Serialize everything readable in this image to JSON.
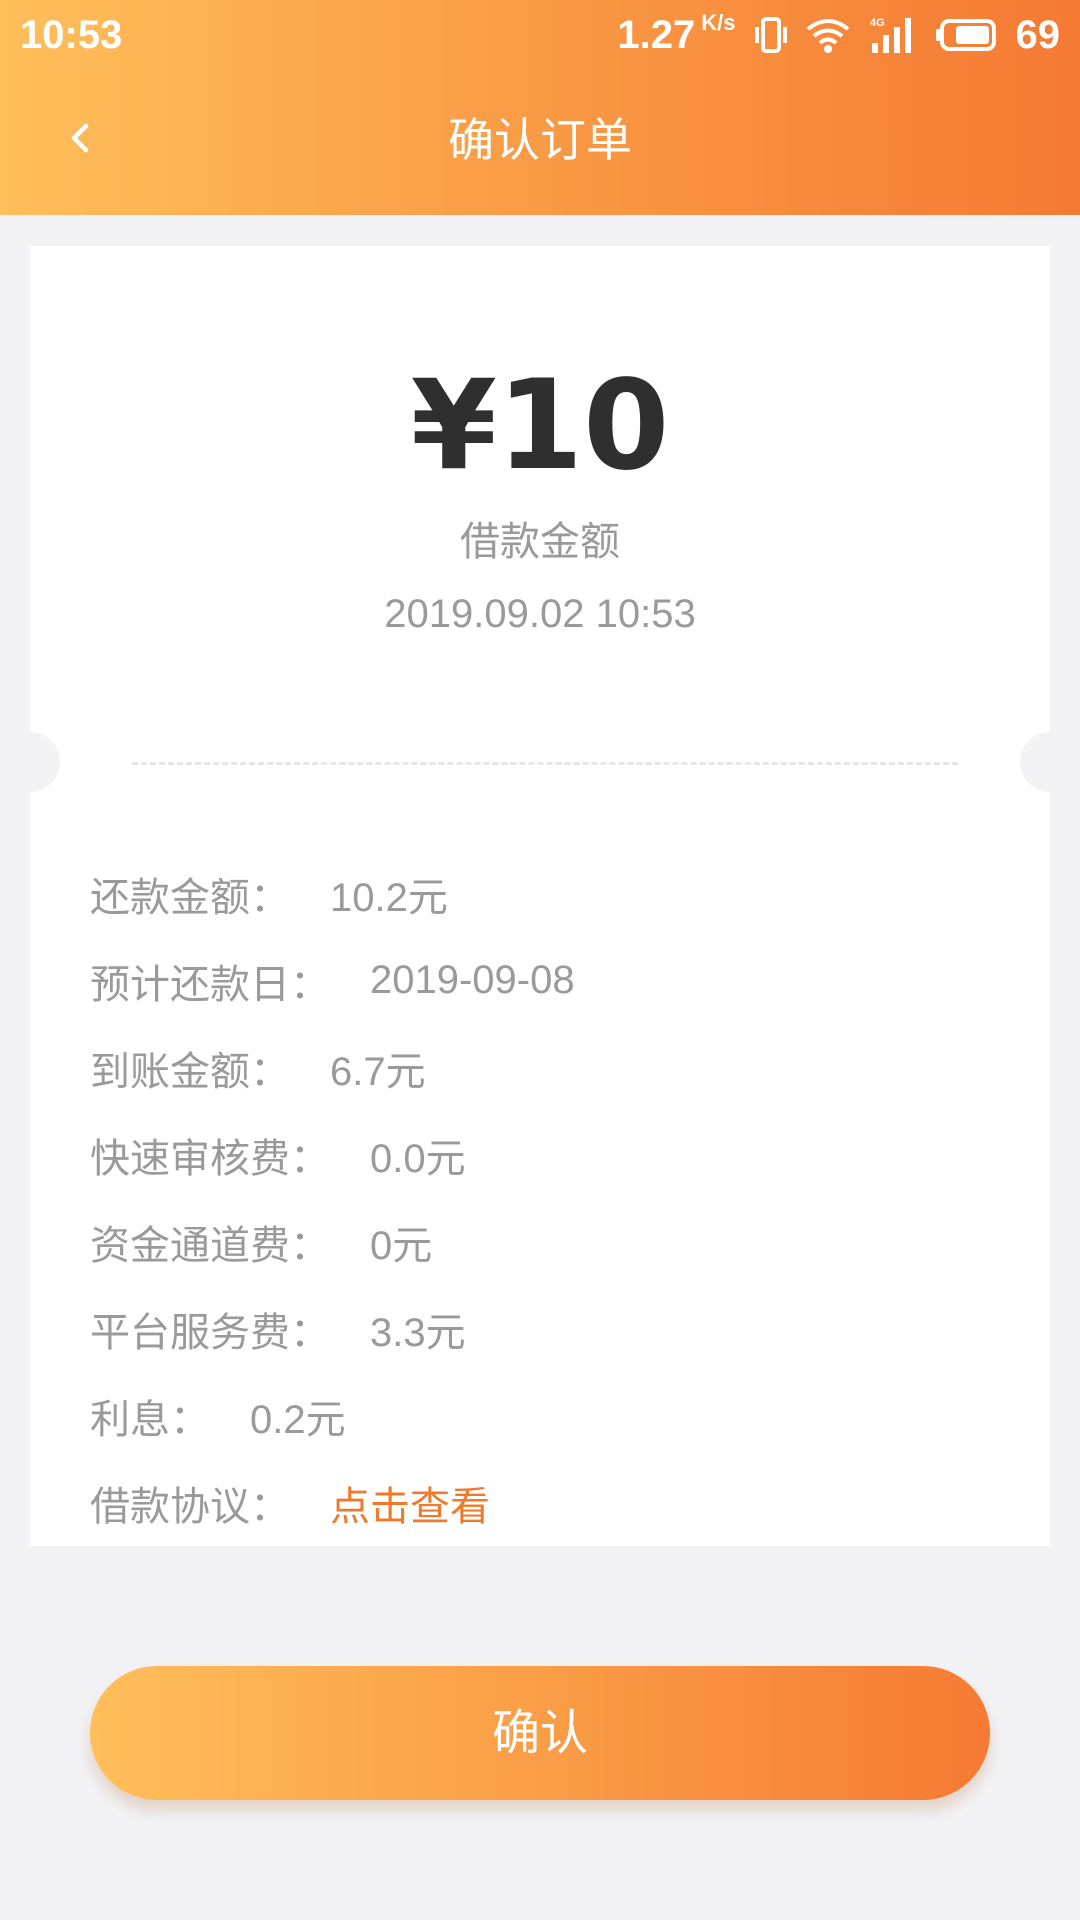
{
  "status_bar": {
    "time": "10:53",
    "net_speed": "1.27",
    "net_unit": "K/s",
    "battery": "69",
    "icons": [
      "vibrate-icon",
      "wifi-icon",
      "signal-4g-icon",
      "battery-icon"
    ]
  },
  "nav": {
    "title": "确认订单",
    "back_icon": "chevron-left-icon"
  },
  "summary": {
    "amount": "¥10",
    "label": "借款金额",
    "datetime": "2019.09.02 10:53"
  },
  "details": [
    {
      "label": "还款金额：",
      "value": "10.2元"
    },
    {
      "label": "预计还款日：",
      "value": "2019-09-08"
    },
    {
      "label": "到账金额：",
      "value": "6.7元"
    },
    {
      "label": "快速审核费：",
      "value": "0.0元"
    },
    {
      "label": "资金通道费：",
      "value": "0元"
    },
    {
      "label": "平台服务费：",
      "value": "3.3元"
    },
    {
      "label": "利息：",
      "value": "0.2元"
    }
  ],
  "agreement": {
    "label": "借款协议：",
    "link": "点击查看"
  },
  "confirm_button": "确认",
  "colors": {
    "header_start": "#ffbf5a",
    "header_end": "#f57a33",
    "link": "#f07a2b",
    "amount_text": "#2f2f2f",
    "muted_text": "#9a9a9a",
    "background": "#f3f3f6"
  }
}
